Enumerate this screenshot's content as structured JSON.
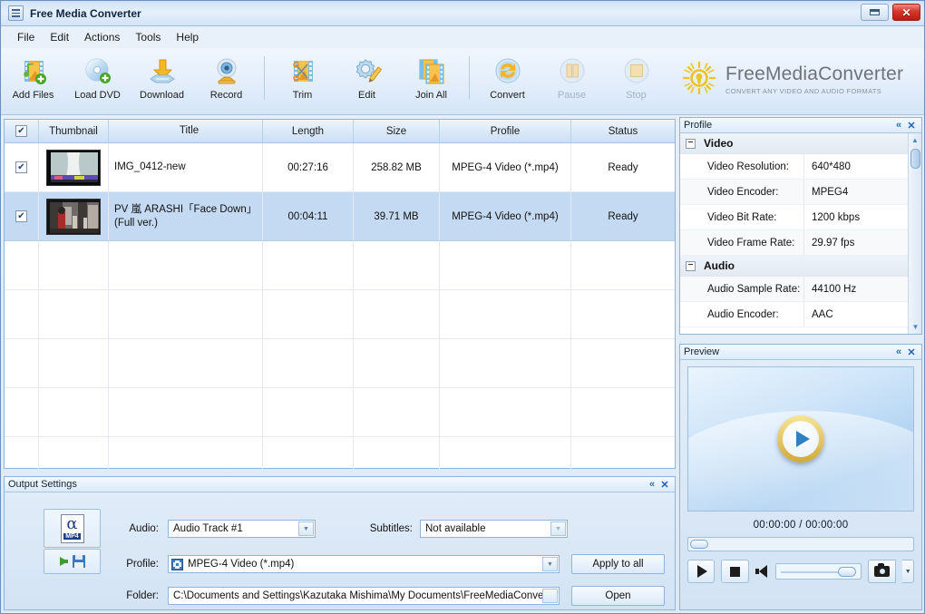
{
  "window": {
    "title": "Free Media Converter",
    "minimize_label": "Minimize",
    "close_label": "✕"
  },
  "menu": {
    "items": [
      {
        "label": "File"
      },
      {
        "label": "Edit"
      },
      {
        "label": "Actions"
      },
      {
        "label": "Tools"
      },
      {
        "label": "Help"
      }
    ]
  },
  "toolbar": {
    "buttons": [
      {
        "label": "Add Files",
        "icon": "add-files-icon",
        "enabled": true
      },
      {
        "label": "Load DVD",
        "icon": "load-dvd-icon",
        "enabled": true
      },
      {
        "label": "Download",
        "icon": "download-icon",
        "enabled": true
      },
      {
        "label": "Record",
        "icon": "record-icon",
        "enabled": true
      },
      {
        "label": "Trim",
        "icon": "trim-icon",
        "enabled": true
      },
      {
        "label": "Edit",
        "icon": "edit-icon",
        "enabled": true
      },
      {
        "label": "Join All",
        "icon": "join-all-icon",
        "enabled": true
      },
      {
        "label": "Convert",
        "icon": "convert-icon",
        "enabled": true
      },
      {
        "label": "Pause",
        "icon": "pause-icon",
        "enabled": false
      },
      {
        "label": "Stop",
        "icon": "stop-icon",
        "enabled": false
      }
    ]
  },
  "brand": {
    "name": "FreeMediaConverter",
    "tagline": "CONVERT ANY VIDEO AND AUDIO FORMATS",
    "logo": "sun-burst-logo"
  },
  "filelist": {
    "headers": [
      "",
      "Thumbnail",
      "Title",
      "Length",
      "Size",
      "Profile",
      "Status"
    ],
    "select_all_checked": true,
    "rows": [
      {
        "checked": true,
        "title": "IMG_0412-new",
        "length": "00:27:16",
        "size": "258.82 MB",
        "profile": "MPEG-4 Video (*.mp4)",
        "status": "Ready",
        "selected": false
      },
      {
        "checked": true,
        "title": "PV 嵐 ARASHI「Face Down」(Full ver.)",
        "length": "00:04:11",
        "size": "39.71 MB",
        "profile": "MPEG-4 Video (*.mp4)",
        "status": "Ready",
        "selected": true
      }
    ],
    "empty_row_count": 5
  },
  "profile_panel": {
    "title": "Profile",
    "collapse_label": "«",
    "close_label": "✕",
    "groups": [
      {
        "name": "Video",
        "rows": [
          {
            "key": "Video Resolution:",
            "value": "640*480"
          },
          {
            "key": "Video Encoder:",
            "value": "MPEG4"
          },
          {
            "key": "Video Bit Rate:",
            "value": "1200 kbps"
          },
          {
            "key": "Video Frame Rate:",
            "value": "29.97 fps"
          }
        ]
      },
      {
        "name": "Audio",
        "rows": [
          {
            "key": "Audio Sample Rate:",
            "value": "44100 Hz"
          },
          {
            "key": "Audio Encoder:",
            "value": "AAC"
          }
        ]
      }
    ]
  },
  "preview_panel": {
    "title": "Preview",
    "collapse_label": "«",
    "close_label": "✕",
    "time": "00:00:00 / 00:00:00",
    "play_overlay": "play-button-overlay",
    "controls": {
      "play": "play-button",
      "stop": "stop-button",
      "mute": "speaker-icon",
      "volume": "volume-slider",
      "snapshot": "snapshot-camera-button",
      "snapshot_menu": "snapshot-dropdown-arrow"
    }
  },
  "output_settings": {
    "title": "Output Settings",
    "collapse_label": "«",
    "close_label": "✕",
    "audio_label": "Audio:",
    "audio_value": "Audio Track #1",
    "subtitles_label": "Subtitles:",
    "subtitles_value": "Not available",
    "profile_label": "Profile:",
    "profile_value": "MPEG-4 Video (*.mp4)",
    "folder_label": "Folder:",
    "folder_value": "C:\\Documents and Settings\\Kazutaka Mishima\\My Documents\\FreeMediaConve",
    "apply_to_all_label": "Apply to all",
    "open_label": "Open",
    "format_icon": "mp4-file-icon",
    "save_icon": "save-to-disk-icon"
  },
  "colors": {
    "accent": "#2f7fc4",
    "close_red": "#d9352b",
    "selection": "#c4daf2",
    "panel_border": "#8fb3d9"
  }
}
